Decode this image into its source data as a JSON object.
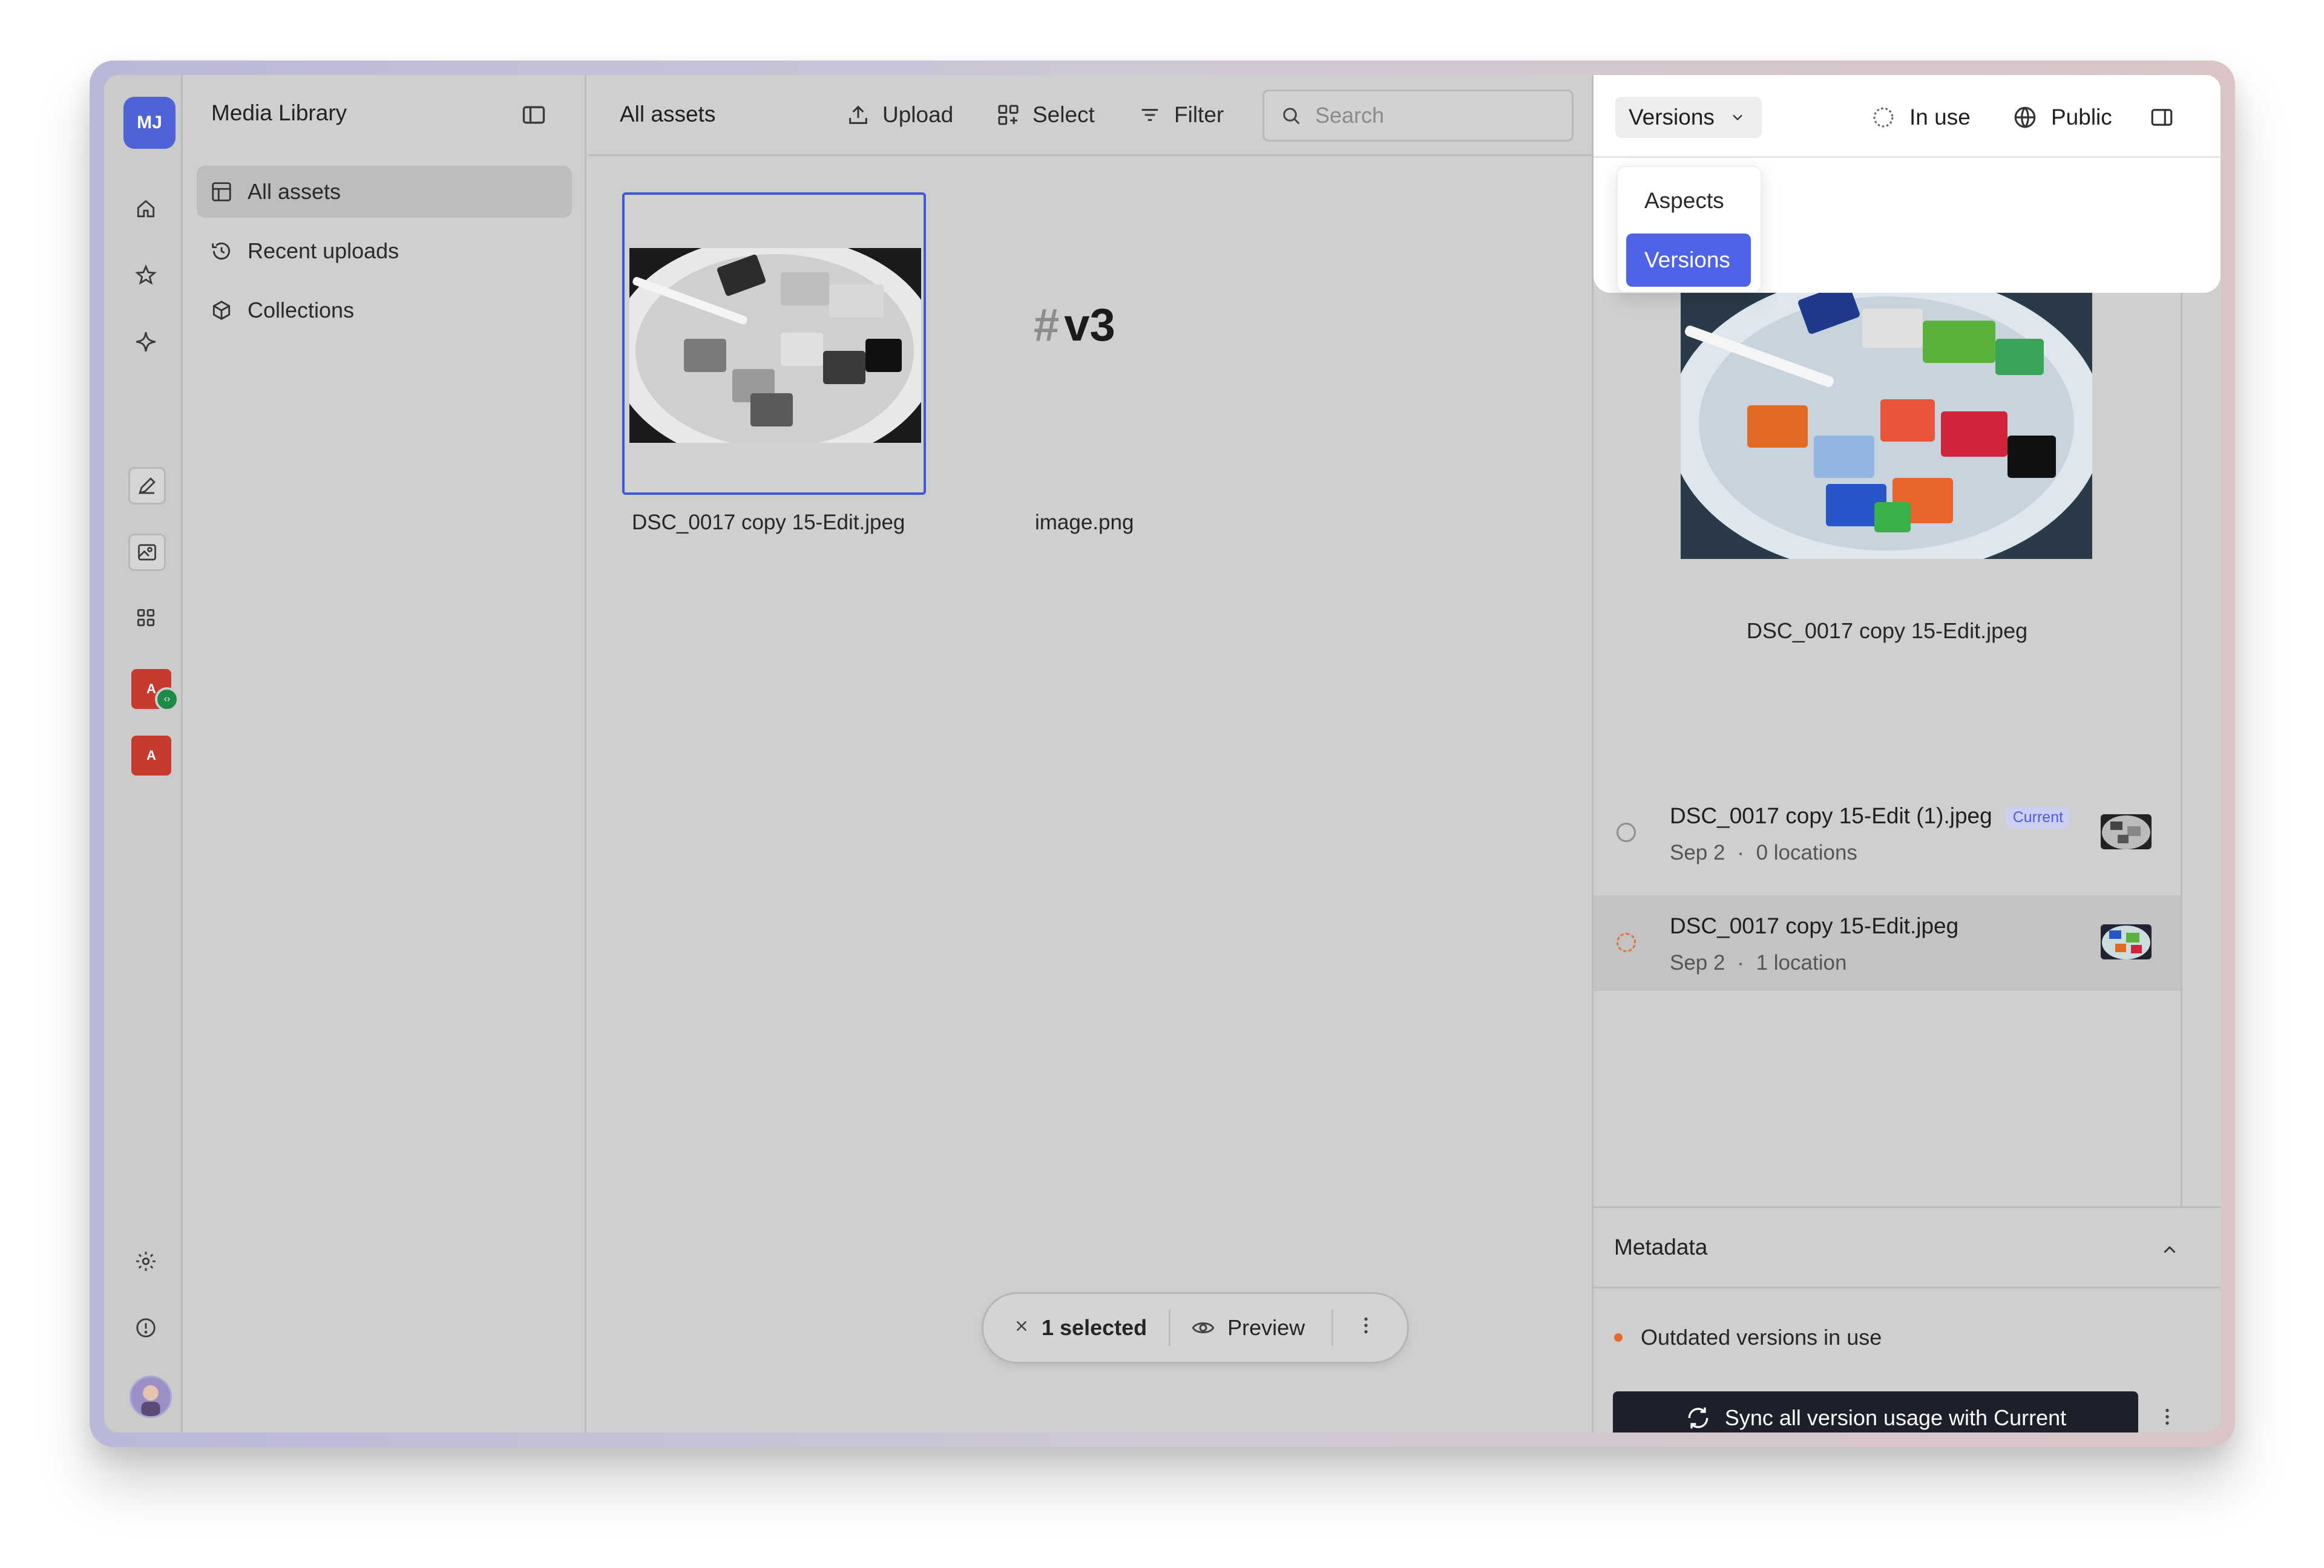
{
  "rail": {
    "avatar_initials": "MJ",
    "app1_letter": "A",
    "app2_letter": "A",
    "icons": [
      "home-icon",
      "star-icon",
      "sparkle-icon",
      "edit-icon",
      "image-icon",
      "grid-icon",
      "settings-icon",
      "help-icon"
    ]
  },
  "sidebar": {
    "title": "Media Library",
    "items": [
      {
        "label": "All assets",
        "icon": "grid-icon"
      },
      {
        "label": "Recent uploads",
        "icon": "history-icon"
      },
      {
        "label": "Collections",
        "icon": "cube-icon"
      }
    ]
  },
  "toolbar": {
    "title": "All assets",
    "upload_label": "Upload",
    "select_label": "Select",
    "filter_label": "Filter",
    "search_placeholder": "Search"
  },
  "assets": [
    {
      "name": "DSC_0017 copy 15-Edit.jpeg",
      "selected": true
    },
    {
      "name": "image.png",
      "tag": "v3"
    }
  ],
  "selection_bar": {
    "count_label": "1 selected",
    "preview_label": "Preview"
  },
  "right_panel": {
    "view_dropdown_label": "Versions",
    "dropdown_options": [
      "Aspects",
      "Versions"
    ],
    "dropdown_selected": "Versions",
    "in_use_label": "In use",
    "public_label": "Public",
    "preview_name": "DSC_0017 copy 15-Edit.jpeg",
    "versions": [
      {
        "name": "DSC_0017 copy 15-Edit (1).jpeg",
        "badge": "Current",
        "date": "Sep 2",
        "locations": "0 locations"
      },
      {
        "name": "DSC_0017 copy 15-Edit.jpeg",
        "badge": "",
        "date": "Sep 2",
        "locations": "1 location"
      }
    ],
    "meta_separator": "·",
    "metadata_title": "Metadata",
    "outdated_label": "Outdated versions in use",
    "sync_button_label": "Sync all version usage with Current"
  },
  "colors": {
    "accent": "#4f63e8",
    "selection_border": "#3f57d6",
    "warning": "#e46b2e",
    "dark_button": "#1d1f2b"
  }
}
